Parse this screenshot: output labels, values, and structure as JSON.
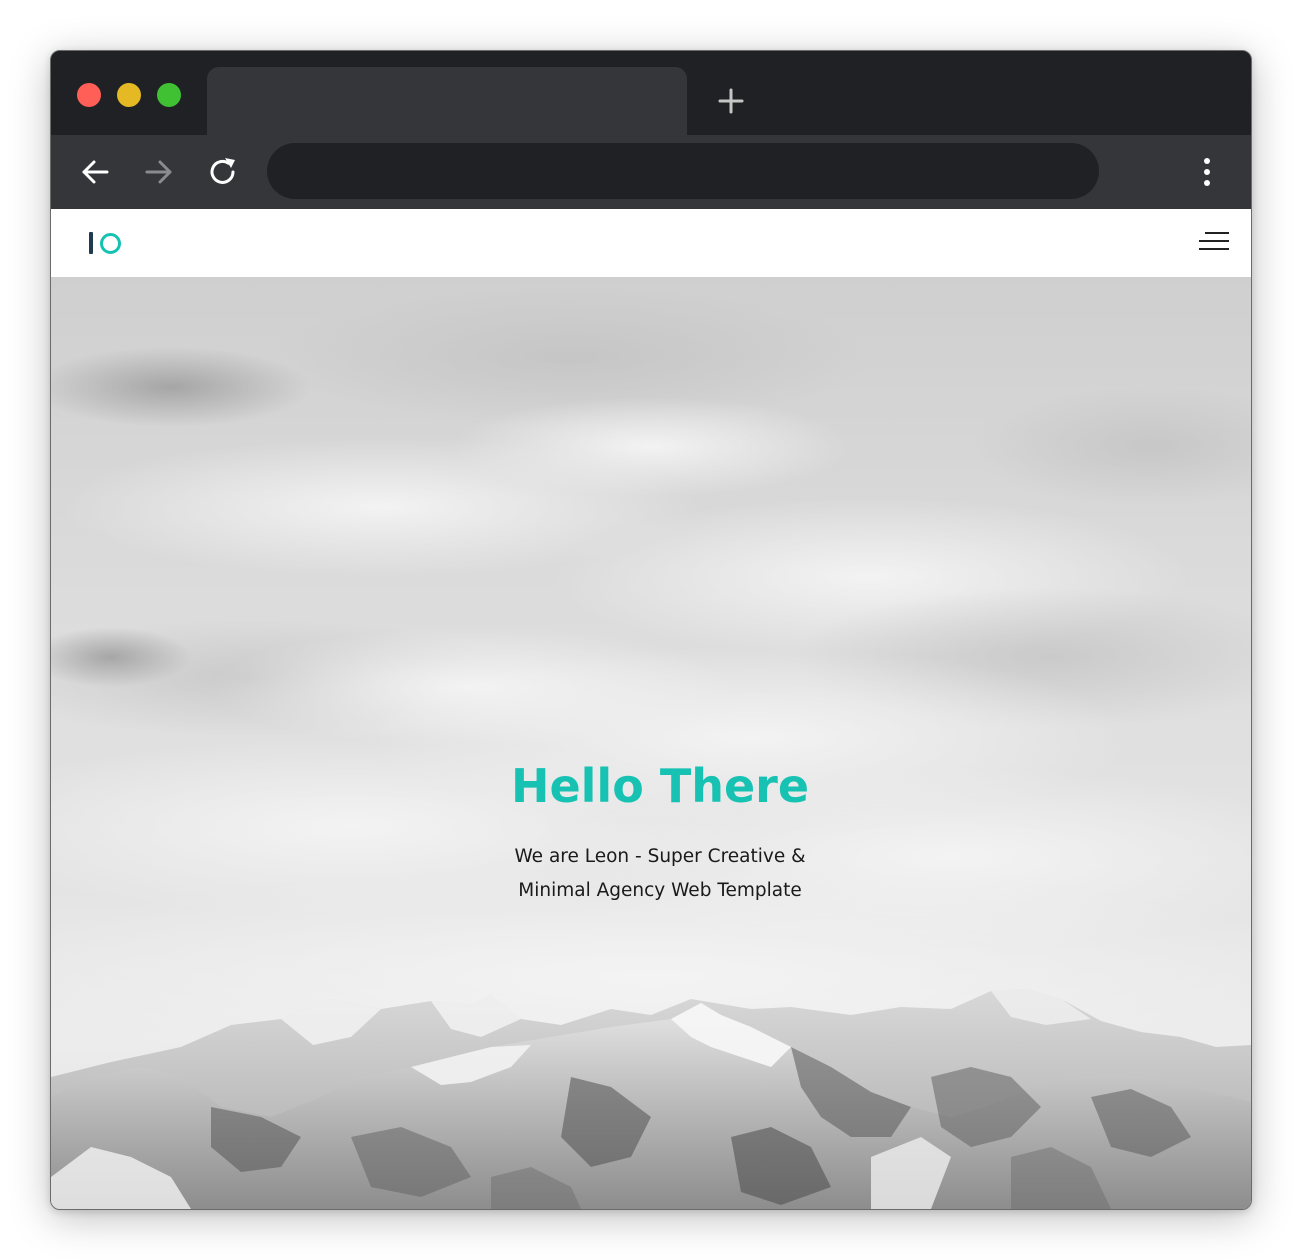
{
  "browser": {
    "tab": {
      "title": ""
    },
    "new_tab_icon": "plus-icon",
    "address_bar": {
      "value": "",
      "placeholder": ""
    },
    "icons": {
      "back": "arrow-left-icon",
      "forward": "arrow-right-icon",
      "reload": "reload-icon",
      "menu": "kebab-menu-icon"
    },
    "colors": {
      "frame": "#202124",
      "toolbar": "#35363a",
      "close": "#ff5f57",
      "minimize": "#e4b923",
      "maximize": "#3fc133"
    }
  },
  "site": {
    "logo": {
      "name": "logo-icon",
      "accent": "#17c2b3",
      "dark": "#1f3b4d"
    },
    "menu_icon": "hamburger-icon",
    "hero": {
      "title": "Hello There",
      "subtitle_line1": "We are Leon - Super Creative &",
      "subtitle_line2": "Minimal Agency Web Template",
      "accent_color": "#17c2b3",
      "background": "grayscale snowy mountain range under cloudy sky"
    }
  }
}
